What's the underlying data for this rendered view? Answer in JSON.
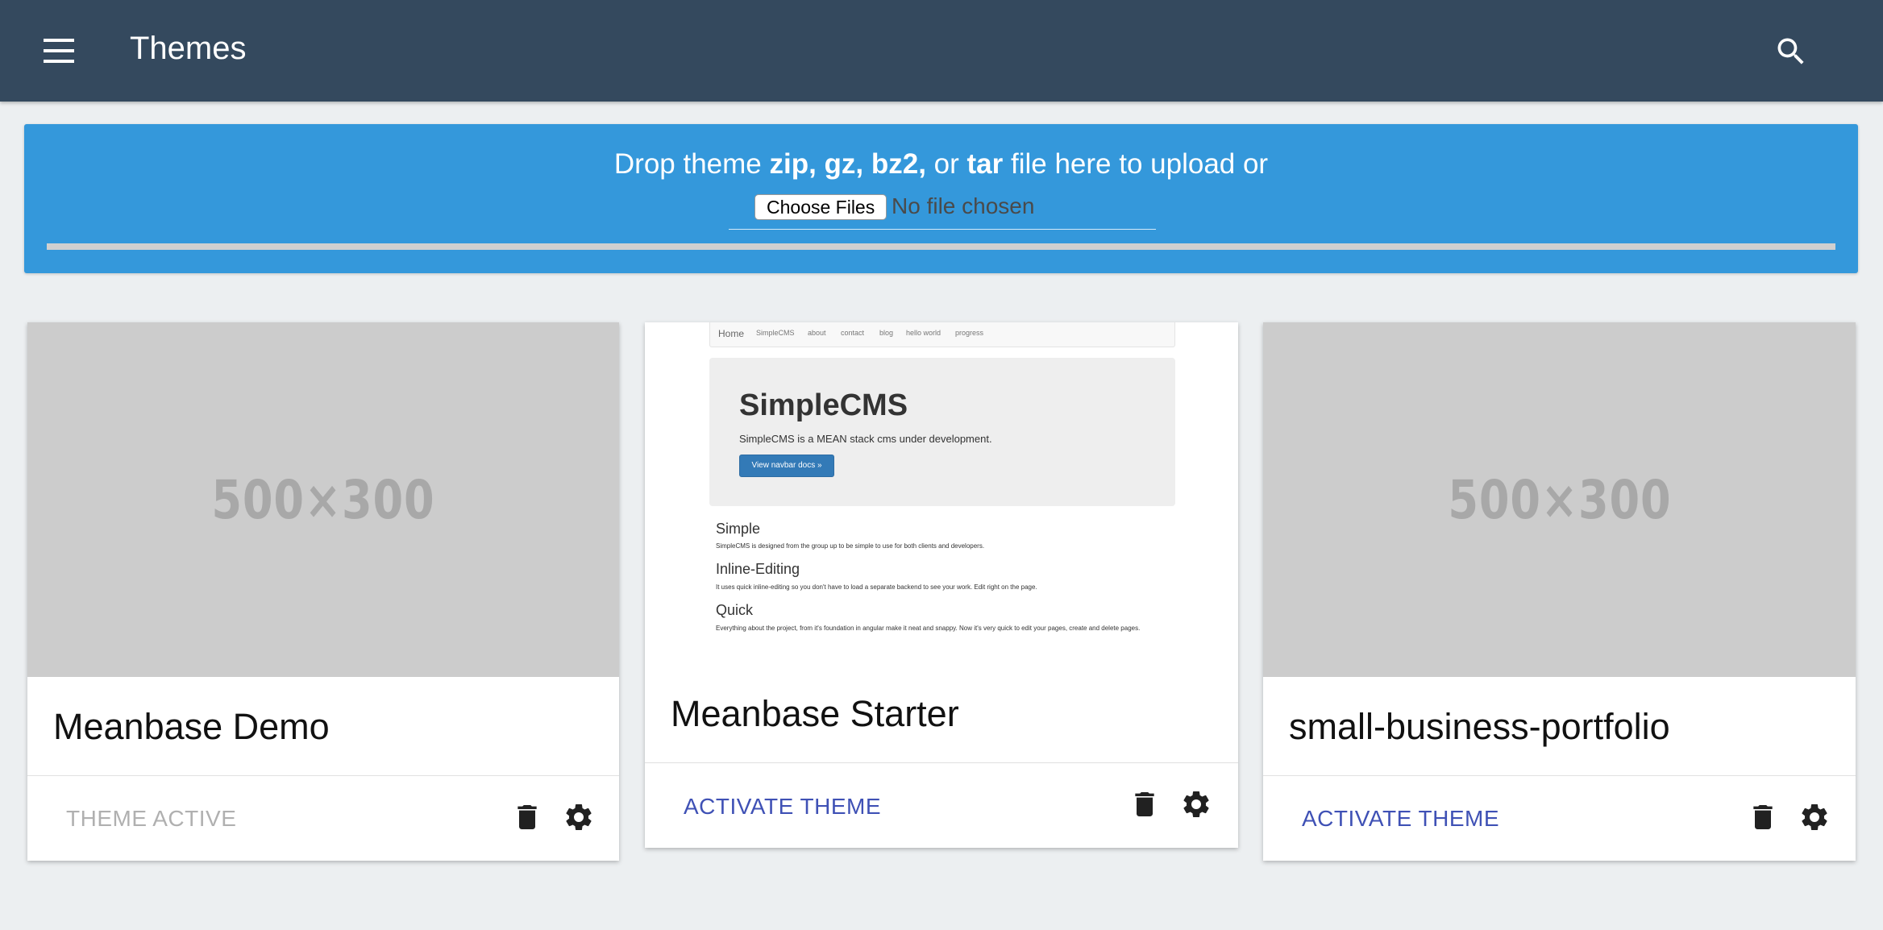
{
  "header": {
    "title": "Themes",
    "menu_icon": "hamburger-menu-icon",
    "search_icon": "search-icon",
    "background": "#34495e"
  },
  "upload": {
    "text_before": "Drop theme ",
    "formats": "zip, gz, bz2,",
    "text_or": " or ",
    "format_tar": "tar",
    "text_after": " file here to upload or",
    "choose_button": "Choose Files",
    "file_status": "No file chosen",
    "progress": 0,
    "background": "#3498db"
  },
  "themes": [
    {
      "title": "Meanbase Demo",
      "thumbnail_text": "500×300",
      "action_label": "THEME ACTIVE",
      "active": true
    },
    {
      "title": "Meanbase Starter",
      "action_label": "ACTIVATE THEME",
      "active": false,
      "preview": {
        "nav": [
          "Home",
          "SimpleCMS",
          "about",
          "contact",
          "blog",
          "hello world",
          "progress"
        ],
        "jumbo_title": "SimpleCMS",
        "jumbo_text": "SimpleCMS is a MEAN stack cms under development.",
        "jumbo_button": "View navbar docs »",
        "sections": [
          {
            "heading": "Simple",
            "text": "SimpleCMS is designed from the group up to be simple to use for both clients and developers."
          },
          {
            "heading": "Inline-Editing",
            "text": "It uses quick inline-editing so you don't have to load a separate backend to see your work. Edit right on the page."
          },
          {
            "heading": "Quick",
            "text": "Everything about the project, from it's foundation in angular make it neat and snappy. Now it's very quick to edit your pages, create and delete pages."
          }
        ]
      }
    },
    {
      "title": "small-business-portfolio",
      "thumbnail_text": "500×300",
      "action_label": "ACTIVATE THEME",
      "active": false
    }
  ],
  "colors": {
    "accent": "#3f51b5",
    "inactive_text": "#b0b0b0",
    "page_bg": "#eceff1"
  }
}
